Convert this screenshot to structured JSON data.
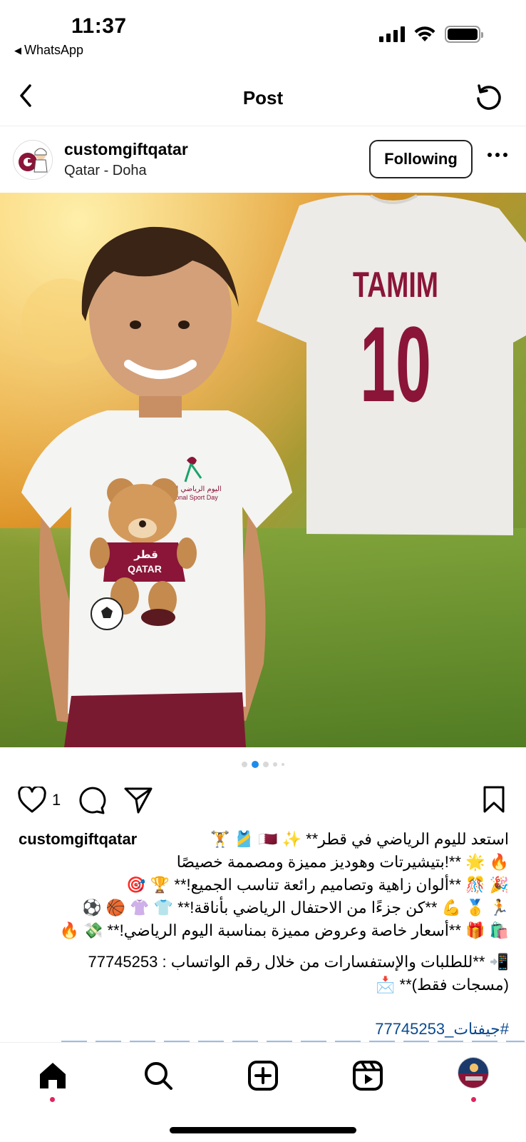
{
  "status": {
    "time": "11:37",
    "back_app": "WhatsApp"
  },
  "header": {
    "title": "Post"
  },
  "post": {
    "username": "customgiftqatar",
    "location": "Qatar - Doha",
    "follow_label": "Following",
    "image": {
      "shirt_name": "TAMIM",
      "shirt_number": "10",
      "bear_chest_text_ar": "قطر",
      "bear_chest_text": "QATAR",
      "logo_text_ar": "اليوم الرياضي للدولة",
      "logo_text": "National Sport Day"
    },
    "carousel": {
      "count": 5,
      "active_index": 1
    },
    "likes": "1",
    "caption": {
      "user": "customgiftqatar",
      "lines": [
        "استعد لليوم الرياضي في قطر** ✨ 🇶🇦 🎽 🏋️",
        "🔥 🌟 **!بتيشيرتات وهوديز مميزة ومصممة خصيصًا",
        "🎉 🎊 **ألوان زاهية وتصاميم رائعة تناسب الجميع!** 🏆 🎯",
        "🏃 🥇 💪 **كن جزءًا من الاحتفال الرياضي بأناقة!** 👕 👚 🏀 ⚽",
        "🛍️ 🎁 **أسعار خاصة وعروض مميزة بمناسبة اليوم الرياضي!** 💸 🔥"
      ],
      "contact_lines": [
        "📲 **للطلبات والإستفسارات من خلال رقم الواتساب : 77745253",
        "(مسجات فقط)** 📩"
      ],
      "hashtag": "#جيفتات_77745253"
    }
  },
  "colors": {
    "maroon": "#8a1538",
    "link": "#0b4a8f",
    "notification_dot": "#e0245e",
    "carousel_active": "#1f8ceb"
  },
  "tabs": [
    "home-icon",
    "search-icon",
    "create-icon",
    "reels-icon",
    "profile-avatar"
  ]
}
